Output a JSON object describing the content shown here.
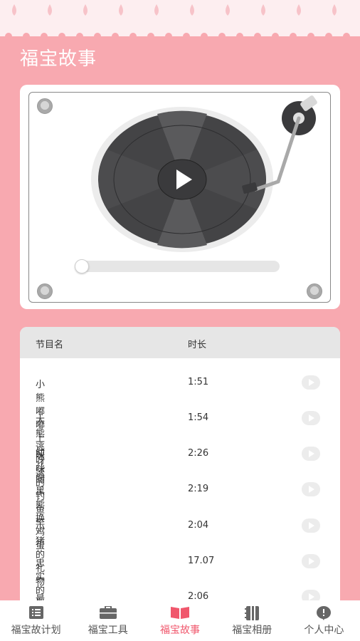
{
  "page": {
    "title": "福宝故事"
  },
  "colors": {
    "background": "#f8a9b0",
    "accent": "#f0576c",
    "lace": "#fdeef0"
  },
  "player": {
    "state": "paused",
    "progress": 0
  },
  "playlist": {
    "headers": {
      "name": "节目名",
      "duration": "时长"
    },
    "items": [
      {
        "name": "小熊嘟嘟上幼儿园",
        "duration": "1:51"
      },
      {
        "name": "大熊逃呀逃",
        "duration": "1:54"
      },
      {
        "name": "咪咪的钓鱼竿",
        "duration": "2:26"
      },
      {
        "name": "黑熊换鸡蛋",
        "duration": "2:19"
      },
      {
        "name": "小猪的礼物",
        "duration": "2:04"
      },
      {
        "name": "忠实的约翰",
        "duration": "17.07"
      },
      {
        "name": "最好的朋友",
        "duration": "2:06"
      }
    ]
  },
  "nav": {
    "items": [
      {
        "label": "福宝故计划",
        "icon": "list-icon"
      },
      {
        "label": "福宝工具",
        "icon": "briefcase-icon"
      },
      {
        "label": "福宝故事",
        "icon": "book-icon",
        "active": true
      },
      {
        "label": "福宝相册",
        "icon": "notebook-icon"
      },
      {
        "label": "个人中心",
        "icon": "chat-icon"
      }
    ]
  }
}
